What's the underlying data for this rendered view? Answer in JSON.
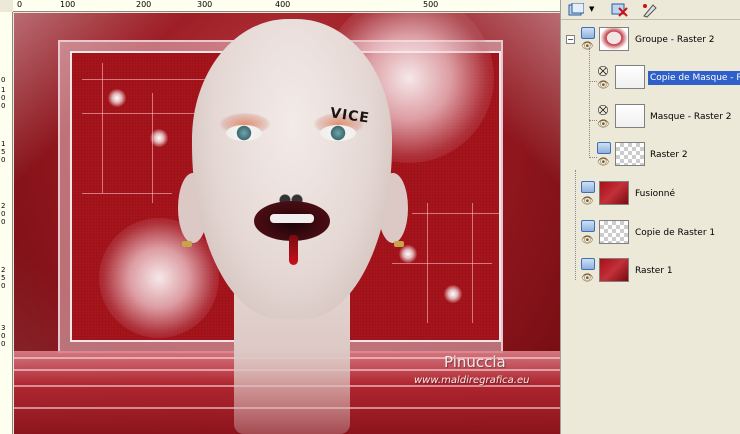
{
  "ruler": {
    "top_labels": [
      "0",
      "100",
      "200",
      "300",
      "400",
      "500"
    ],
    "left_labels": [
      "0",
      "1",
      "0",
      "0",
      "1",
      "5",
      "0",
      "2",
      "0",
      "0",
      "2",
      "5",
      "0",
      "3",
      "0",
      "0"
    ]
  },
  "canvas": {
    "tattoo_text": "VICE",
    "watermark_name": "Pinuccia",
    "watermark_url": "www.maldiregrafica.eu"
  },
  "layers_panel": {
    "toolbar": {
      "new_layer_icon": "new-raster-layer-icon",
      "delete_icon": "delete-layer-icon",
      "edit_icon": "edit-layer-icon"
    },
    "layers": [
      {
        "name": "Groupe - Raster 2",
        "type": "group",
        "thumb": "face",
        "visible": true,
        "selected": false
      },
      {
        "name": "Copie de Masque - R",
        "type": "mask",
        "thumb": "white",
        "visible": true,
        "selected": true
      },
      {
        "name": "Masque - Raster 2",
        "type": "mask",
        "thumb": "white",
        "visible": true,
        "selected": false
      },
      {
        "name": "Raster 2",
        "type": "raster",
        "thumb": "checker",
        "visible": true,
        "selected": false
      },
      {
        "name": "Fusionné",
        "type": "raster",
        "thumb": "red",
        "visible": true,
        "selected": false
      },
      {
        "name": "Copie de Raster 1",
        "type": "raster",
        "thumb": "checker",
        "visible": true,
        "selected": false
      },
      {
        "name": "Raster 1",
        "type": "raster",
        "thumb": "red",
        "visible": true,
        "selected": false
      }
    ]
  }
}
